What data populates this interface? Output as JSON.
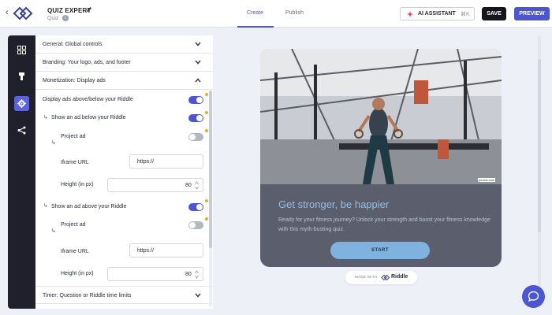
{
  "header": {
    "title": "QUIZ EXPERT",
    "subtitle": "Quiz",
    "tabs": [
      {
        "label": "Create",
        "active": true
      },
      {
        "label": "Publish",
        "active": false
      }
    ],
    "ai_button_label": "AI ASSISTANT",
    "ai_shortcut": "⌘K",
    "save_label": "SAVE",
    "preview_label": "PREVIEW",
    "accent_color": "#4c56cf"
  },
  "rail": {
    "items": [
      {
        "icon": "grid-icon",
        "active": false
      },
      {
        "icon": "paint-brush-icon",
        "active": false
      },
      {
        "icon": "gear-icon",
        "active": true
      },
      {
        "icon": "share-icon",
        "active": false
      }
    ]
  },
  "settings": {
    "sections": [
      {
        "label": "General: Global controls",
        "expanded": false
      },
      {
        "label": "Branding: Your logo, ads, and footer",
        "expanded": false
      },
      {
        "label": "Monetization: Display ads",
        "expanded": true
      },
      {
        "label": "Timer: Question or Riddle time limits",
        "expanded": false
      }
    ],
    "monetization": {
      "display_ads": {
        "label": "Display ads above/below your Riddle",
        "on": true
      },
      "below": {
        "label": "Show an ad below your Riddle",
        "on": true,
        "project_ad": {
          "label": "Project ad",
          "on": false
        },
        "iframe_label": "Iframe URL",
        "iframe_value": "https://",
        "height_label": "Height (in px)",
        "height_value": "80"
      },
      "above": {
        "label": "Show an ad above your Riddle",
        "on": true,
        "project_ad": {
          "label": "Project ad",
          "on": false
        },
        "iframe_label": "Iframe URL",
        "iframe_value": "https://",
        "height_label": "Height (in px)",
        "height_value": "80"
      }
    }
  },
  "preview": {
    "photo_credit": "pexels.com",
    "title": "Get stronger, be happier",
    "description": "Ready for your fitness journey? Unlock your strength and boost your fitness knowledge with this myth-busting quiz.",
    "start_label": "START",
    "made_with_label": "MADE WITH",
    "brand": "Riddle"
  }
}
